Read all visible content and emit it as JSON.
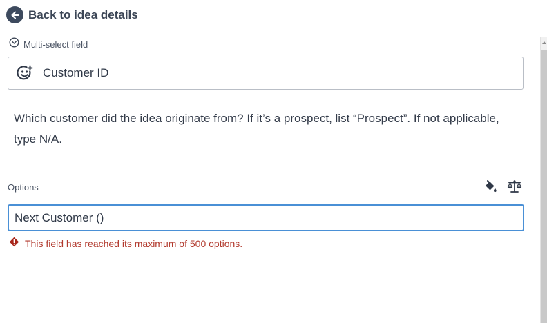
{
  "back": {
    "label": "Back to idea details",
    "icon": "arrow-left-icon"
  },
  "field": {
    "type_label": "Multi-select field",
    "type_icon": "chevron-circle-down-icon",
    "name": "Customer ID",
    "name_icon": "smiley-plus-icon",
    "description": "Which customer did the idea originate from? If it’s a prospect, list “Prospect”. If not applicable, type N/A."
  },
  "options": {
    "label": "Options",
    "tools": [
      "paint-bucket-icon",
      "balance-scale-icon"
    ],
    "input_value": "Next Customer ()",
    "error_icon": "warning-diamond-icon",
    "error_text": "This field has reached its maximum of 500 options."
  },
  "colors": {
    "focus_border": "#4a90d6",
    "error": "#b23a2e",
    "back_circle": "#3d4a5e"
  }
}
